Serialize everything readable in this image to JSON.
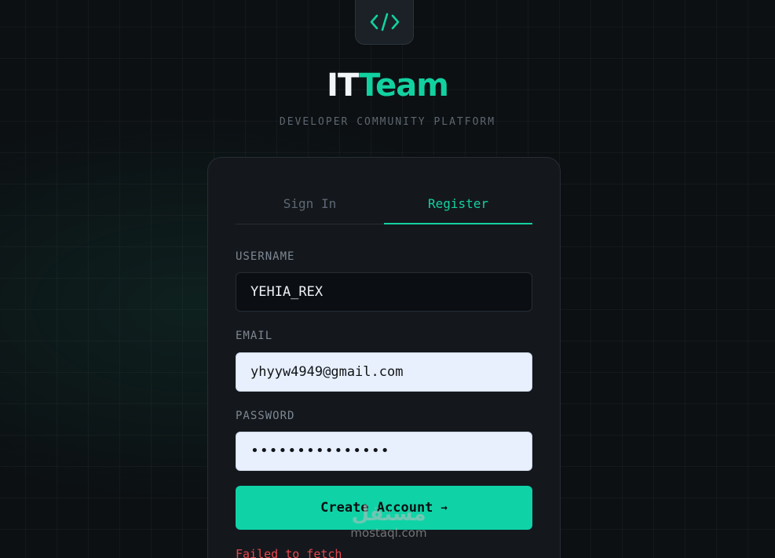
{
  "logo": {
    "icon": "code-icon",
    "glyph": "</>"
  },
  "brand": {
    "part1": "IT",
    "part2": "Team"
  },
  "tagline": "DEVELOPER COMMUNITY PLATFORM",
  "tabs": [
    {
      "label": "Sign In",
      "active": false
    },
    {
      "label": "Register",
      "active": true
    }
  ],
  "form": {
    "username": {
      "label": "USERNAME",
      "value": "YEHIA_REX"
    },
    "email": {
      "label": "EMAIL",
      "value": "yhyyw4949@gmail.com"
    },
    "password": {
      "label": "PASSWORD",
      "value": "•••••••••••••••"
    },
    "submit_label": "Create Account",
    "submit_arrow": "→",
    "error": "Failed to fetch"
  },
  "watermark": {
    "arabic": "مستقل",
    "latin": "mostaql.com"
  },
  "colors": {
    "accent": "#12d1a0",
    "error": "#e5484d",
    "background": "#0c1013",
    "card": "#14181d"
  }
}
